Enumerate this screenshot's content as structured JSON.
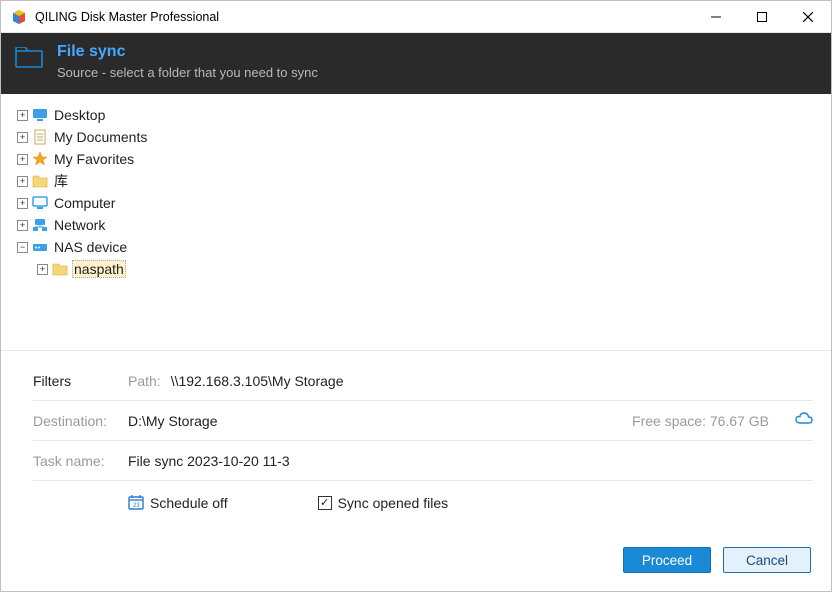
{
  "window": {
    "title": "QILING Disk Master Professional"
  },
  "header": {
    "title": "File sync",
    "subtitle": "Source - select a folder that you need to sync"
  },
  "tree": {
    "desktop": "Desktop",
    "my_documents": "My Documents",
    "my_favorites": "My Favorites",
    "libraries": "库",
    "computer": "Computer",
    "network": "Network",
    "nas_device": "NAS device",
    "naspath": "naspath"
  },
  "filters": {
    "label": "Filters",
    "path_label": "Path:",
    "path_value": "\\\\192.168.3.105\\My Storage"
  },
  "destination": {
    "label": "Destination:",
    "value": "D:\\My Storage",
    "free_space": "Free space: 76.67 GB"
  },
  "task": {
    "label": "Task name:",
    "value": "File sync 2023-10-20 11-3"
  },
  "options": {
    "schedule": "Schedule off",
    "sync_opened": "Sync opened files"
  },
  "buttons": {
    "proceed": "Proceed",
    "cancel": "Cancel"
  }
}
